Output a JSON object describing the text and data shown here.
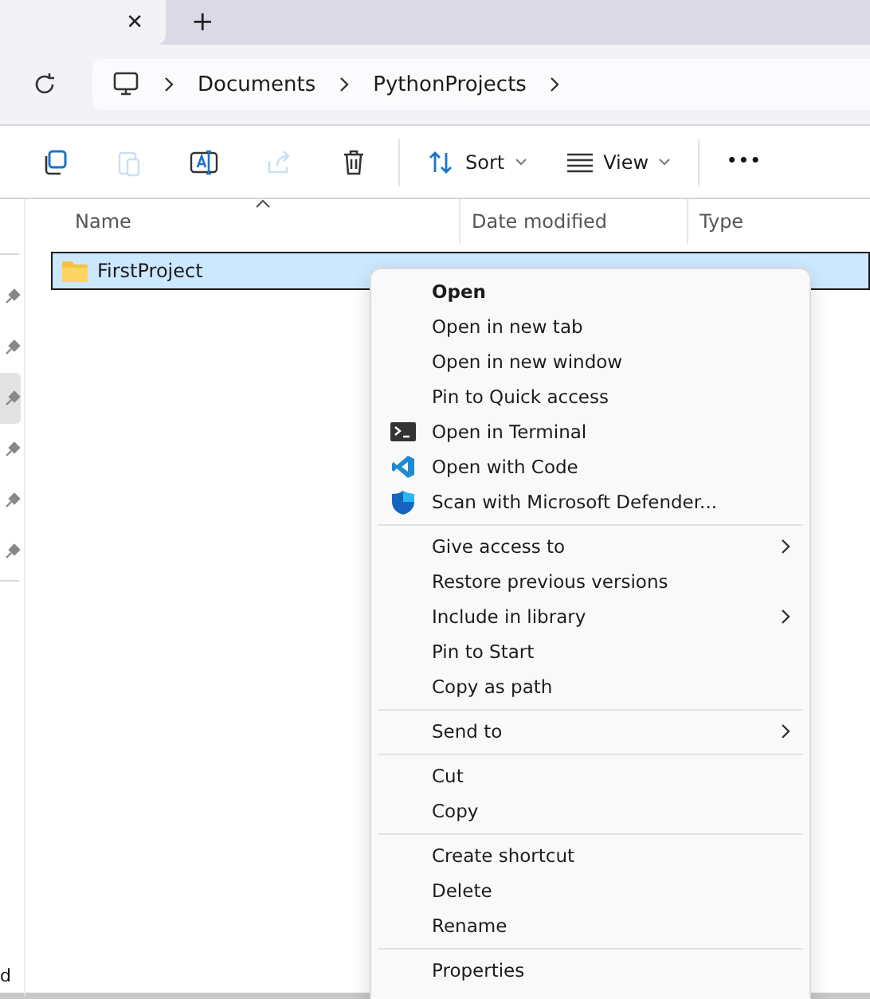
{
  "tabs": [
    {
      "close": "✕"
    }
  ],
  "new_tab": "+",
  "breadcrumb": [
    "Documents",
    "PythonProjects"
  ],
  "toolbar": {
    "actions": [
      {
        "kind": "copy",
        "disabled": false
      },
      {
        "kind": "paste",
        "disabled": true
      },
      {
        "kind": "rename",
        "disabled": false
      },
      {
        "kind": "share",
        "disabled": true
      },
      {
        "kind": "delete",
        "disabled": false
      }
    ],
    "sort": "Sort",
    "view": "View",
    "more": "•••"
  },
  "columns": [
    "Name",
    "Date modified",
    "Type"
  ],
  "rows": [
    {
      "name": "FirstProject",
      "selected": true
    }
  ],
  "sidebar": {
    "pins": [
      {
        "selected": false
      },
      {
        "selected": false
      },
      {
        "selected": true
      },
      {
        "selected": false
      },
      {
        "selected": false
      },
      {
        "selected": false
      }
    ],
    "footer": "d"
  },
  "context_menu": [
    {
      "kind": "item",
      "label": "Open",
      "bold": true
    },
    {
      "kind": "item",
      "label": "Open in new tab"
    },
    {
      "kind": "item",
      "label": "Open in new window"
    },
    {
      "kind": "item",
      "label": "Pin to Quick access"
    },
    {
      "kind": "terminal",
      "label": "Open in Terminal"
    },
    {
      "kind": "code",
      "label": "Open with Code"
    },
    {
      "kind": "shield",
      "label": "Scan with Microsoft Defender..."
    },
    {
      "kind": "separator"
    },
    {
      "kind": "item",
      "label": "Give access to",
      "submenu": true
    },
    {
      "kind": "item",
      "label": "Restore previous versions"
    },
    {
      "kind": "item",
      "label": "Include in library",
      "submenu": true
    },
    {
      "kind": "item",
      "label": "Pin to Start"
    },
    {
      "kind": "item",
      "label": "Copy as path"
    },
    {
      "kind": "separator"
    },
    {
      "kind": "item",
      "label": "Send to",
      "submenu": true
    },
    {
      "kind": "separator"
    },
    {
      "kind": "item",
      "label": "Cut"
    },
    {
      "kind": "item",
      "label": "Copy"
    },
    {
      "kind": "separator"
    },
    {
      "kind": "item",
      "label": "Create shortcut"
    },
    {
      "kind": "item",
      "label": "Delete"
    },
    {
      "kind": "item",
      "label": "Rename"
    },
    {
      "kind": "separator"
    },
    {
      "kind": "item",
      "label": "Properties"
    }
  ]
}
